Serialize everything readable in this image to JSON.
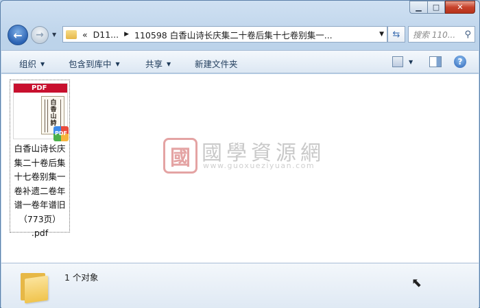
{
  "window": {
    "minimize_symbol": "▁",
    "maximize_symbol": "□",
    "close_symbol": "✕"
  },
  "nav": {
    "back_symbol": "←",
    "forward_symbol": "→",
    "history_symbol": "▼",
    "address": {
      "prefix": "«",
      "crumb_1": "D11...",
      "separator": "▶",
      "crumb_2": "110598 白香山诗长庆集二十卷后集十七卷别集一...",
      "dropdown_symbol": "▼"
    },
    "refresh_symbol": "⇆",
    "search_placeholder": "搜索 110...",
    "search_icon": "⚲"
  },
  "commandbar": {
    "organize": "组织",
    "include_in_library": "包含到库中",
    "share": "共享",
    "new_folder": "新建文件夹",
    "dropdown_symbol": "▼",
    "help_symbol": "?"
  },
  "file": {
    "thumb_banner": "PDF",
    "thumb_title": "白香山詩",
    "badge": "PDF",
    "name_lines": [
      "白香山诗长庆",
      "集二十卷后集",
      "十七卷别集一",
      "卷补遗二卷年",
      "谱一卷年谱旧",
      "（773页）",
      ".pdf"
    ]
  },
  "watermark": {
    "logo_char": "國",
    "title": "國學資源網",
    "url": "www.guoxueziyuan.com"
  },
  "details": {
    "count": "1 个对象"
  }
}
